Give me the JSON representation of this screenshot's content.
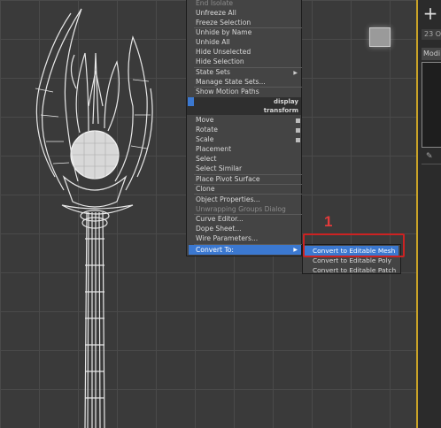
{
  "quad_menu": {
    "items_top": [
      {
        "label": "End Isolate",
        "enabled": false
      },
      {
        "label": "Unfreeze All",
        "enabled": true
      },
      {
        "label": "Freeze Selection",
        "enabled": true
      },
      {
        "label": "Unhide by Name",
        "enabled": true
      },
      {
        "label": "Unhide All",
        "enabled": true
      },
      {
        "label": "Hide Unselected",
        "enabled": true
      },
      {
        "label": "Hide Selection",
        "enabled": true
      },
      {
        "label": "State Sets",
        "enabled": true
      },
      {
        "label": "Manage State Sets...",
        "enabled": true
      },
      {
        "label": "Show Motion Paths",
        "enabled": true
      }
    ],
    "display_header": "display",
    "transform_header": "transform",
    "items_transform": [
      {
        "label": "Move"
      },
      {
        "label": "Rotate"
      },
      {
        "label": "Scale"
      },
      {
        "label": "Placement"
      },
      {
        "label": "Select"
      },
      {
        "label": "Select Similar"
      },
      {
        "label": "Place Pivot Surface"
      },
      {
        "label": "Clone"
      },
      {
        "label": "Object Properties..."
      },
      {
        "label": "Unwrapping Groups Dialog",
        "enabled": false
      },
      {
        "label": "Curve Editor..."
      },
      {
        "label": "Dope Sheet..."
      },
      {
        "label": "Wire Parameters..."
      }
    ],
    "convert_to": "Convert To:"
  },
  "sub_menu": {
    "items": [
      {
        "label": "Convert to Editable Mesh",
        "highlighted": true
      },
      {
        "label": "Convert to Editable Poly",
        "highlighted": false
      },
      {
        "label": "Convert to Editable Patch",
        "highlighted": false
      }
    ]
  },
  "annotation": {
    "step_number": "1",
    "color": "#cc2222"
  },
  "right_panel": {
    "plus_label": "+",
    "top_field": "23 Ob",
    "modifier_label": "Modi"
  },
  "colors": {
    "accent": "#3b78d0",
    "viewport_border": "#c9a227",
    "menu_bg": "#444444"
  }
}
